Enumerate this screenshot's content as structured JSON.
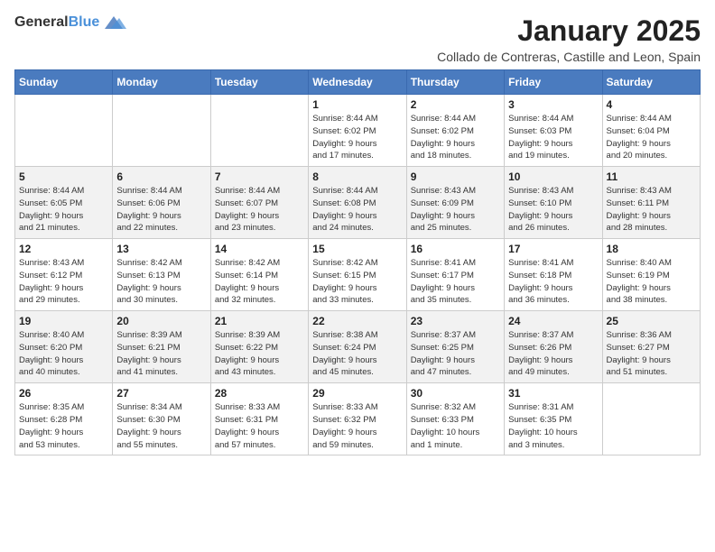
{
  "header": {
    "logo_general": "General",
    "logo_blue": "Blue",
    "month_title": "January 2025",
    "subtitle": "Collado de Contreras, Castille and Leon, Spain"
  },
  "weekdays": [
    "Sunday",
    "Monday",
    "Tuesday",
    "Wednesday",
    "Thursday",
    "Friday",
    "Saturday"
  ],
  "weeks": [
    [
      {
        "day": "",
        "detail": ""
      },
      {
        "day": "",
        "detail": ""
      },
      {
        "day": "",
        "detail": ""
      },
      {
        "day": "1",
        "detail": "Sunrise: 8:44 AM\nSunset: 6:02 PM\nDaylight: 9 hours\nand 17 minutes."
      },
      {
        "day": "2",
        "detail": "Sunrise: 8:44 AM\nSunset: 6:02 PM\nDaylight: 9 hours\nand 18 minutes."
      },
      {
        "day": "3",
        "detail": "Sunrise: 8:44 AM\nSunset: 6:03 PM\nDaylight: 9 hours\nand 19 minutes."
      },
      {
        "day": "4",
        "detail": "Sunrise: 8:44 AM\nSunset: 6:04 PM\nDaylight: 9 hours\nand 20 minutes."
      }
    ],
    [
      {
        "day": "5",
        "detail": "Sunrise: 8:44 AM\nSunset: 6:05 PM\nDaylight: 9 hours\nand 21 minutes."
      },
      {
        "day": "6",
        "detail": "Sunrise: 8:44 AM\nSunset: 6:06 PM\nDaylight: 9 hours\nand 22 minutes."
      },
      {
        "day": "7",
        "detail": "Sunrise: 8:44 AM\nSunset: 6:07 PM\nDaylight: 9 hours\nand 23 minutes."
      },
      {
        "day": "8",
        "detail": "Sunrise: 8:44 AM\nSunset: 6:08 PM\nDaylight: 9 hours\nand 24 minutes."
      },
      {
        "day": "9",
        "detail": "Sunrise: 8:43 AM\nSunset: 6:09 PM\nDaylight: 9 hours\nand 25 minutes."
      },
      {
        "day": "10",
        "detail": "Sunrise: 8:43 AM\nSunset: 6:10 PM\nDaylight: 9 hours\nand 26 minutes."
      },
      {
        "day": "11",
        "detail": "Sunrise: 8:43 AM\nSunset: 6:11 PM\nDaylight: 9 hours\nand 28 minutes."
      }
    ],
    [
      {
        "day": "12",
        "detail": "Sunrise: 8:43 AM\nSunset: 6:12 PM\nDaylight: 9 hours\nand 29 minutes."
      },
      {
        "day": "13",
        "detail": "Sunrise: 8:42 AM\nSunset: 6:13 PM\nDaylight: 9 hours\nand 30 minutes."
      },
      {
        "day": "14",
        "detail": "Sunrise: 8:42 AM\nSunset: 6:14 PM\nDaylight: 9 hours\nand 32 minutes."
      },
      {
        "day": "15",
        "detail": "Sunrise: 8:42 AM\nSunset: 6:15 PM\nDaylight: 9 hours\nand 33 minutes."
      },
      {
        "day": "16",
        "detail": "Sunrise: 8:41 AM\nSunset: 6:17 PM\nDaylight: 9 hours\nand 35 minutes."
      },
      {
        "day": "17",
        "detail": "Sunrise: 8:41 AM\nSunset: 6:18 PM\nDaylight: 9 hours\nand 36 minutes."
      },
      {
        "day": "18",
        "detail": "Sunrise: 8:40 AM\nSunset: 6:19 PM\nDaylight: 9 hours\nand 38 minutes."
      }
    ],
    [
      {
        "day": "19",
        "detail": "Sunrise: 8:40 AM\nSunset: 6:20 PM\nDaylight: 9 hours\nand 40 minutes."
      },
      {
        "day": "20",
        "detail": "Sunrise: 8:39 AM\nSunset: 6:21 PM\nDaylight: 9 hours\nand 41 minutes."
      },
      {
        "day": "21",
        "detail": "Sunrise: 8:39 AM\nSunset: 6:22 PM\nDaylight: 9 hours\nand 43 minutes."
      },
      {
        "day": "22",
        "detail": "Sunrise: 8:38 AM\nSunset: 6:24 PM\nDaylight: 9 hours\nand 45 minutes."
      },
      {
        "day": "23",
        "detail": "Sunrise: 8:37 AM\nSunset: 6:25 PM\nDaylight: 9 hours\nand 47 minutes."
      },
      {
        "day": "24",
        "detail": "Sunrise: 8:37 AM\nSunset: 6:26 PM\nDaylight: 9 hours\nand 49 minutes."
      },
      {
        "day": "25",
        "detail": "Sunrise: 8:36 AM\nSunset: 6:27 PM\nDaylight: 9 hours\nand 51 minutes."
      }
    ],
    [
      {
        "day": "26",
        "detail": "Sunrise: 8:35 AM\nSunset: 6:28 PM\nDaylight: 9 hours\nand 53 minutes."
      },
      {
        "day": "27",
        "detail": "Sunrise: 8:34 AM\nSunset: 6:30 PM\nDaylight: 9 hours\nand 55 minutes."
      },
      {
        "day": "28",
        "detail": "Sunrise: 8:33 AM\nSunset: 6:31 PM\nDaylight: 9 hours\nand 57 minutes."
      },
      {
        "day": "29",
        "detail": "Sunrise: 8:33 AM\nSunset: 6:32 PM\nDaylight: 9 hours\nand 59 minutes."
      },
      {
        "day": "30",
        "detail": "Sunrise: 8:32 AM\nSunset: 6:33 PM\nDaylight: 10 hours\nand 1 minute."
      },
      {
        "day": "31",
        "detail": "Sunrise: 8:31 AM\nSunset: 6:35 PM\nDaylight: 10 hours\nand 3 minutes."
      },
      {
        "day": "",
        "detail": ""
      }
    ]
  ]
}
